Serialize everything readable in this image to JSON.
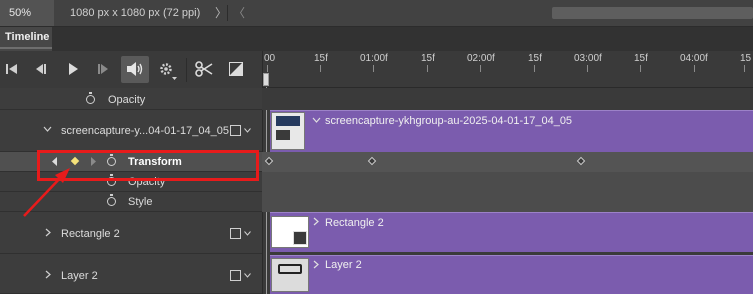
{
  "status_bar": {
    "zoom": "50%",
    "doc_info": "1080 px x 1080 px (72 ppi)",
    "expand_glyph": "〉",
    "back_glyph": "〈"
  },
  "panel": {
    "tab_label": "Timeline"
  },
  "toolbar": {
    "icons": [
      "go-to-first-frame-icon",
      "previous-frame-icon",
      "play-icon",
      "next-frame-icon",
      "audio-icon",
      "settings-gear-icon",
      "split-at-playhead-icon",
      "transition-icon"
    ]
  },
  "ruler": {
    "labels": [
      "00",
      "15f",
      "01:00f",
      "15f",
      "02:00f",
      "15f",
      "03:00f",
      "15f",
      "04:00f",
      "15"
    ]
  },
  "layers": {
    "top_property": "Opacity",
    "group1": {
      "name": "screencapture-y...04-01-17_04_05",
      "clip_name": "screencapture-ykhgroup-au-2025-04-01-17_04_05",
      "properties": [
        "Transform",
        "Opacity",
        "Style"
      ]
    },
    "rect": {
      "name": "Rectangle 2",
      "clip_name": "Rectangle 2"
    },
    "layer2": {
      "name": "Layer 2",
      "clip_name": "Layer 2"
    }
  },
  "colors": {
    "clip": "#7b5cae",
    "annotation": "#e81b1b",
    "keyframe_selected": "#f5e27a"
  }
}
